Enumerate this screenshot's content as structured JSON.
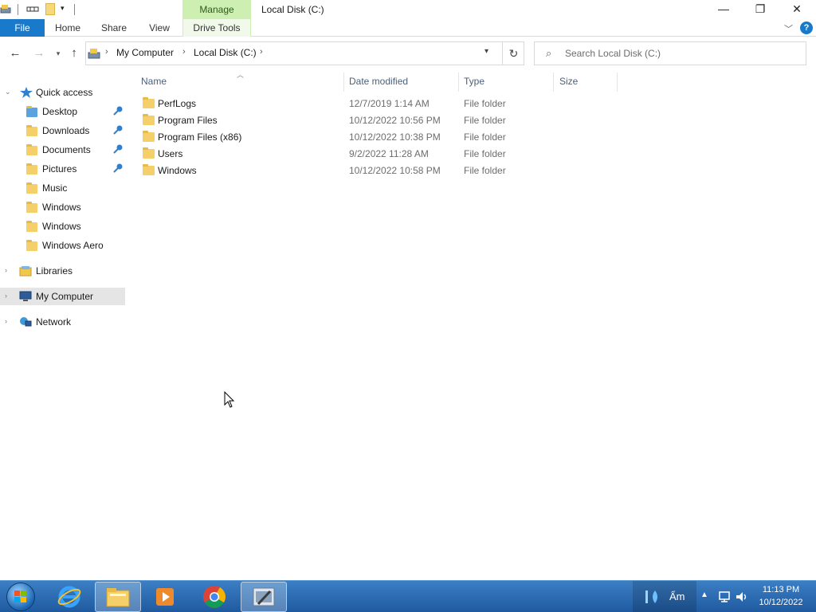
{
  "window": {
    "title": "Local Disk (C:)",
    "context_tab": "Manage",
    "controls": {
      "minimize": "—",
      "maximize": "❐",
      "close": "✕"
    }
  },
  "ribbon": {
    "tabs": [
      "File",
      "Home",
      "Share",
      "View",
      "Drive Tools"
    ],
    "accent_color": "#1979ca",
    "context_color": "#cdefb1",
    "help_label": "?"
  },
  "address": {
    "crumbs": [
      "My Computer",
      "Local Disk (C:)"
    ],
    "search_placeholder": "Search Local Disk (C:)"
  },
  "navpane": {
    "quick_access": "Quick access",
    "quick_items": [
      {
        "label": "Desktop",
        "pinned": true
      },
      {
        "label": "Downloads",
        "pinned": true
      },
      {
        "label": "Documents",
        "pinned": true
      },
      {
        "label": "Pictures",
        "pinned": true
      },
      {
        "label": "Music",
        "pinned": false
      },
      {
        "label": "Windows",
        "pinned": false
      },
      {
        "label": "Windows",
        "pinned": false
      },
      {
        "label": "Windows Aero",
        "pinned": false
      }
    ],
    "libraries": "Libraries",
    "computer": "My Computer",
    "network": "Network"
  },
  "list": {
    "columns": [
      "Name",
      "Date modified",
      "Type",
      "Size"
    ],
    "rows": [
      {
        "name": "PerfLogs",
        "date": "12/7/2019 1:14 AM",
        "type": "File folder"
      },
      {
        "name": "Program Files",
        "date": "10/12/2022 10:56 PM",
        "type": "File folder"
      },
      {
        "name": "Program Files (x86)",
        "date": "10/12/2022 10:38 PM",
        "type": "File folder"
      },
      {
        "name": "Users",
        "date": "9/2/2022 11:28 AM",
        "type": "File folder"
      },
      {
        "name": "Windows",
        "date": "10/12/2022 10:58 PM",
        "type": "File folder"
      }
    ]
  },
  "taskbar": {
    "weather": "Ẩm",
    "time": "11:13 PM",
    "date": "10/12/2022"
  }
}
